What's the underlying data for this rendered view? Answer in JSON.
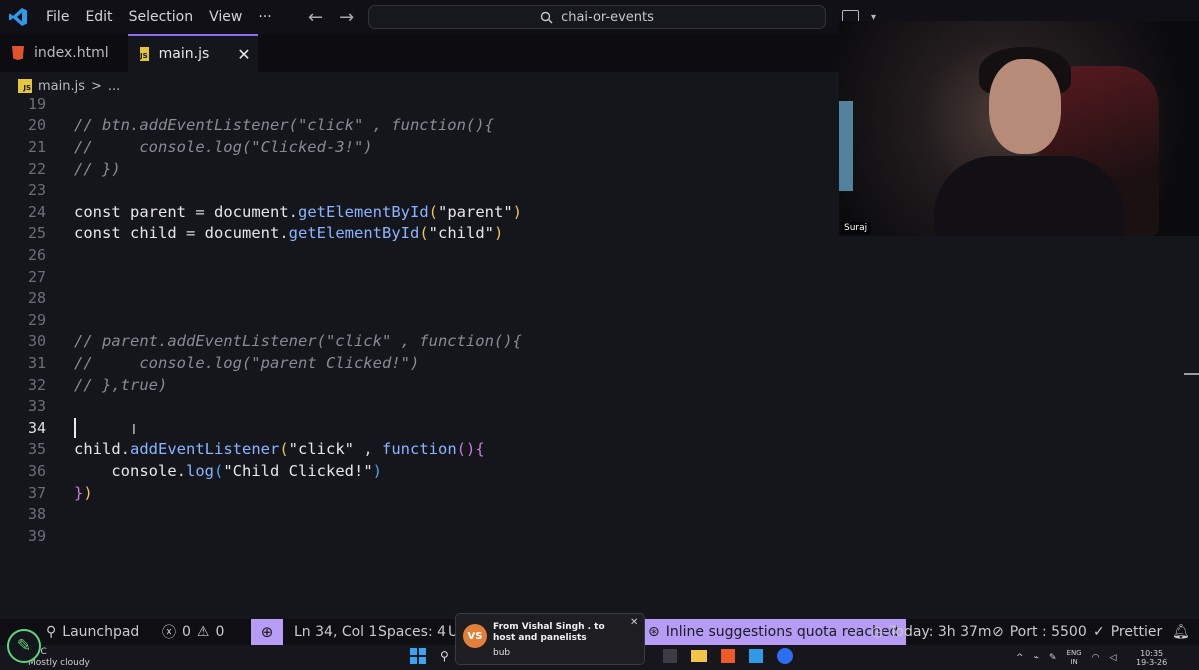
{
  "menu": [
    "File",
    "Edit",
    "Selection",
    "View",
    "···"
  ],
  "search": {
    "text": "chai-or-events"
  },
  "tabs": [
    {
      "label": "index.html",
      "icon": "html5-icon",
      "active": false
    },
    {
      "label": "main.js",
      "icon": "js-file-icon",
      "active": true
    }
  ],
  "breadcrumb": {
    "file": "main.js",
    "sep": ">",
    "rest": "..."
  },
  "editor": {
    "current_line": 34,
    "lines": [
      {
        "n": "19"
      },
      {
        "n": "20",
        "parts": [
          [
            "cm",
            "// btn.addEventListener(\"click\" , function(){"
          ]
        ]
      },
      {
        "n": "21",
        "parts": [
          [
            "cm",
            "//     console.log(\"Clicked-3!\")"
          ]
        ]
      },
      {
        "n": "22",
        "parts": [
          [
            "cm",
            "// })"
          ]
        ]
      },
      {
        "n": "23"
      },
      {
        "n": "24",
        "parts": [
          [
            "kw",
            "const "
          ],
          [
            "vr",
            "parent"
          ],
          [
            "pu",
            " = "
          ],
          [
            "vr",
            "document"
          ],
          [
            "pu",
            "."
          ],
          [
            "fn",
            "getElementById"
          ],
          [
            "p1",
            "("
          ],
          [
            "st",
            "\"parent\""
          ],
          [
            "p1",
            ")"
          ]
        ]
      },
      {
        "n": "25",
        "parts": [
          [
            "kw",
            "const "
          ],
          [
            "vr",
            "child"
          ],
          [
            "pu",
            " = "
          ],
          [
            "vr",
            "document"
          ],
          [
            "pu",
            "."
          ],
          [
            "fn",
            "getElementById"
          ],
          [
            "p1",
            "("
          ],
          [
            "st",
            "\"child\""
          ],
          [
            "p1",
            ")"
          ]
        ]
      },
      {
        "n": "26"
      },
      {
        "n": "27"
      },
      {
        "n": "28"
      },
      {
        "n": "29"
      },
      {
        "n": "30",
        "parts": [
          [
            "cm",
            "// parent.addEventListener(\"click\" , function(){"
          ]
        ]
      },
      {
        "n": "31",
        "parts": [
          [
            "cm",
            "//     console.log(\"parent Clicked!\")"
          ]
        ]
      },
      {
        "n": "32",
        "parts": [
          [
            "cm",
            "// },true)"
          ]
        ]
      },
      {
        "n": "33"
      },
      {
        "n": "34"
      },
      {
        "n": "35",
        "parts": [
          [
            "vr",
            "child"
          ],
          [
            "pu",
            "."
          ],
          [
            "fn",
            "addEventListener"
          ],
          [
            "p1",
            "("
          ],
          [
            "st",
            "\"click\""
          ],
          [
            "pu",
            " , "
          ],
          [
            "fn",
            "function"
          ],
          [
            "p2",
            "()"
          ],
          [
            "p2",
            "{"
          ]
        ]
      },
      {
        "n": "36",
        "parts": [
          [
            "pu",
            "    "
          ],
          [
            "vr",
            "console"
          ],
          [
            "pu",
            "."
          ],
          [
            "fn",
            "log"
          ],
          [
            "p3",
            "("
          ],
          [
            "st",
            "\"Child Clicked!\""
          ],
          [
            "p3",
            ")"
          ]
        ]
      },
      {
        "n": "37",
        "parts": [
          [
            "p2",
            "}"
          ],
          [
            "p1",
            ")"
          ]
        ]
      },
      {
        "n": "38"
      },
      {
        "n": "39"
      }
    ]
  },
  "webcam": {
    "name": "Suraj"
  },
  "statusbar": {
    "launchpad": "Launchpad",
    "errors": "0",
    "warnings": "0",
    "position": "Ln 34, Col 1",
    "spaces": "Spaces: 4",
    "encoding": "U",
    "quota": "Inline suggestions quota reached",
    "time": "Today: 3h 37m",
    "port": "Port : 5500",
    "prettier": "Prettier"
  },
  "notification": {
    "initials": "VS",
    "title": "From Vishal Singh . to host and panelists",
    "message": "bub"
  },
  "taskbar": {
    "weather_temp": "°C",
    "weather_text": "Mostly cloudy",
    "lang": "ENG",
    "region": "IN",
    "time": "10:35",
    "date": "19-3-26"
  },
  "colors": {
    "accent": "#b69cf5",
    "comment": "#8a8a94",
    "function": "#8ab4ff"
  }
}
